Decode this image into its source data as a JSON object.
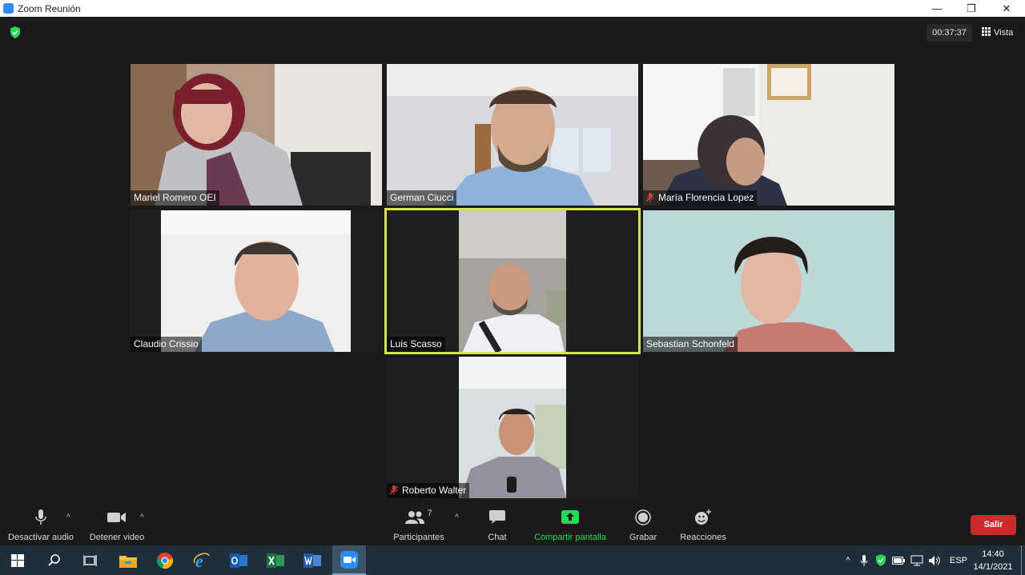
{
  "window": {
    "title": "Zoom Reunión",
    "minimize": "—",
    "restore": "❐",
    "close": "✕"
  },
  "meeting": {
    "timer": "00:37:37",
    "view_label": "Vista",
    "security_color": "#23d959",
    "active_speaker_color": "#d8e34f"
  },
  "participants": [
    {
      "name": "Mariel Romero OEI",
      "muted": false
    },
    {
      "name": "German Ciucci",
      "muted": false
    },
    {
      "name": "María Florencia Lopez",
      "muted": true
    },
    {
      "name": "Claudio Crissio",
      "muted": false
    },
    {
      "name": "Luis Scasso",
      "muted": false,
      "active_speaker": true
    },
    {
      "name": "Sebastian Schonfeld",
      "muted": false
    },
    {
      "name": "Roberto Walter",
      "muted": true
    }
  ],
  "toolbar": {
    "audio_label": "Desactivar audio",
    "video_label": "Detener video",
    "participants_label": "Participantes",
    "participants_count": "7",
    "chat_label": "Chat",
    "share_label": "Compartir pantalla",
    "record_label": "Grabar",
    "reactions_label": "Reacciones",
    "leave_label": "Salir",
    "share_color": "#23d959",
    "leave_color": "#cc2b2b"
  },
  "taskbar": {
    "language": "ESP",
    "time": "14:40",
    "date": "14/1/2021",
    "apps": [
      "windows-start",
      "search",
      "task-view",
      "file-explorer",
      "chrome",
      "internet-explorer",
      "outlook",
      "excel",
      "word",
      "zoom"
    ]
  }
}
